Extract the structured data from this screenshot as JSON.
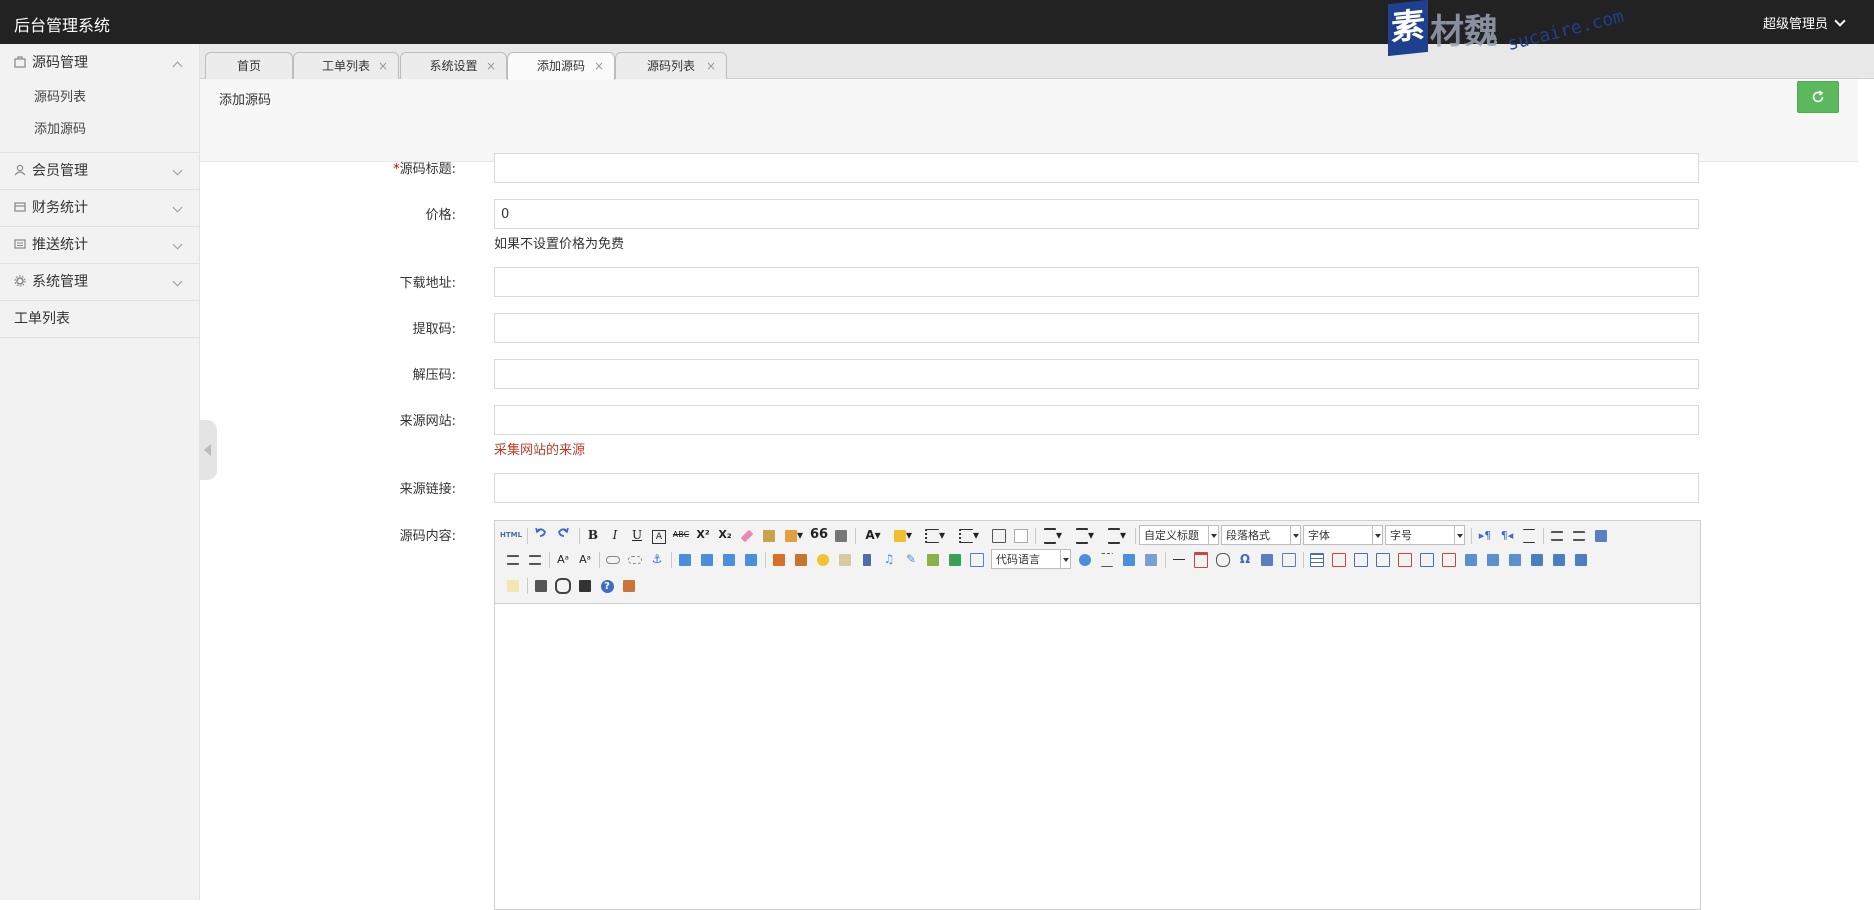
{
  "header": {
    "title": "后台管理系统",
    "user": "超级管理员"
  },
  "watermark": {
    "seal": "素",
    "text": "材魏",
    "url": "sucaire.com"
  },
  "sidebar": {
    "groups": [
      {
        "label": "源码管理",
        "icon": "package-icon",
        "expanded": true,
        "items": [
          "源码列表",
          "添加源码"
        ]
      },
      {
        "label": "会员管理",
        "icon": "user-icon",
        "expanded": false
      },
      {
        "label": "财务统计",
        "icon": "finance-icon",
        "expanded": false
      },
      {
        "label": "推送统计",
        "icon": "push-icon",
        "expanded": false
      },
      {
        "label": "系统管理",
        "icon": "gear-icon",
        "expanded": false
      }
    ],
    "single": "工单列表"
  },
  "tabs": [
    {
      "label": "首页",
      "closable": false,
      "active": false
    },
    {
      "label": "工单列表",
      "closable": true,
      "active": false
    },
    {
      "label": "系统设置",
      "closable": true,
      "active": false
    },
    {
      "label": "添加源码",
      "closable": true,
      "active": true
    },
    {
      "label": "源码列表",
      "closable": true,
      "active": false
    }
  ],
  "tab_close": "×",
  "page": {
    "title": "添加源码"
  },
  "colors": {
    "header_bg": "#222222",
    "refresh_button": "#5cb85c",
    "required": "#cc0000",
    "hint_red": "#c0392b"
  },
  "form": {
    "required_mark": "*",
    "title_label": "源码标题:",
    "title_value": "",
    "price_label": "价格:",
    "price_value": "0",
    "price_hint": "如果不设置价格为免费",
    "download_label": "下载地址:",
    "download_value": "",
    "extract_label": "提取码:",
    "extract_value": "",
    "unzip_label": "解压码:",
    "unzip_value": "",
    "source_site_label": "来源网站:",
    "source_site_value": "",
    "source_site_hint": "采集网站的来源",
    "source_link_label": "来源链接:",
    "source_link_value": "",
    "content_label": "源码内容:"
  },
  "editor": {
    "selects": {
      "custom_heading": "自定义标题",
      "paragraph": "段落格式",
      "font": "字体",
      "font_size": "字号",
      "code_lang": "代码语言"
    },
    "glyphs": {
      "html": "HTML",
      "bold": "B",
      "italic": "I",
      "underline": "U",
      "strike": "ABC",
      "sup": "X²",
      "sub": "X₂",
      "quote": "66",
      "font_color": "A",
      "anchor": "⚓",
      "omega": "Ω",
      "help": "?"
    }
  }
}
